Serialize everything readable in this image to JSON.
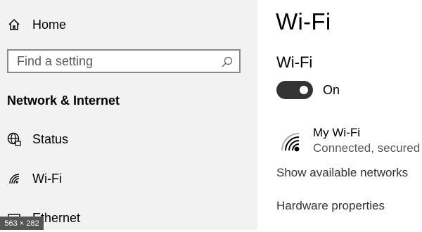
{
  "sidebar": {
    "home_label": "Home",
    "home_icon": "home-icon",
    "search": {
      "placeholder": "Find a setting",
      "icon": "search-icon"
    },
    "section_header": "Network & Internet",
    "items": [
      {
        "label": "Status",
        "icon": "globe-icon"
      },
      {
        "label": "Wi-Fi",
        "icon": "wifi-icon"
      },
      {
        "label": "Ethernet",
        "icon": "ethernet-icon"
      }
    ]
  },
  "main": {
    "title": "Wi-Fi",
    "wifi_section_title": "Wi-Fi",
    "toggle": {
      "state": "On",
      "on": true
    },
    "network": {
      "name": "My Wi-Fi",
      "status": "Connected, secured"
    },
    "links": {
      "show_networks": "Show available networks",
      "hardware": "Hardware properties"
    }
  },
  "overlay": {
    "size_badge": "563 × 282"
  },
  "colors": {
    "sidebar_bg": "#f2f2f2",
    "main_bg": "#ffffff",
    "toggle_on": "#333333"
  }
}
